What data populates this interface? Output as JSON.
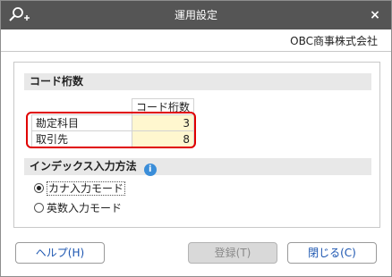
{
  "window": {
    "title": "運用設定",
    "close_glyph": "×"
  },
  "company": "OBC商事株式会社",
  "digits_section": {
    "header": "コード桁数",
    "column_header": "コード桁数",
    "rows": [
      {
        "name": "勘定科目",
        "value": "3"
      },
      {
        "name": "取引先",
        "value": "8"
      }
    ]
  },
  "index_section": {
    "header": "インデックス入力方法",
    "info_glyph": "i",
    "options": [
      {
        "label": "カナ入力モード",
        "selected": true
      },
      {
        "label": "英数入力モード",
        "selected": false
      }
    ]
  },
  "buttons": {
    "help": "ヘルプ(H)",
    "register": "登録(T)",
    "close": "閉じる(C)"
  },
  "colors": {
    "titlebar": "#555555",
    "value_cell": "#fff7cf",
    "highlight": "#e00000",
    "info": "#3b8ed9",
    "link_text": "#1a54b0"
  },
  "icons": {
    "titlebar_left": "search-plus-icon",
    "titlebar_right": "close-icon",
    "section_info": "info-icon"
  }
}
